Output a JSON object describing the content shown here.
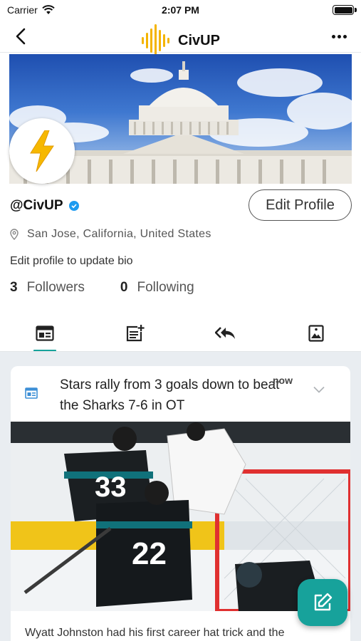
{
  "status_bar": {
    "carrier": "Carrier",
    "time": "2:07 PM"
  },
  "nav": {
    "app_name": "CivUP",
    "back_icon": "chevron-left-icon",
    "more_icon": "more-horizontal-icon",
    "logo_icon": "soundwave-logo-icon"
  },
  "profile": {
    "handle": "@CivUP",
    "verified": true,
    "edit_label": "Edit Profile",
    "location": "San Jose, California, United States",
    "bio": "Edit profile to update bio",
    "followers_count": "3",
    "followers_label": "Followers",
    "following_count": "0",
    "following_label": "Following",
    "avatar_icon": "lightning-bolt-icon",
    "cover_image": "capitol-building-photo"
  },
  "tabs": [
    {
      "name": "posts",
      "icon": "article-icon",
      "active": true
    },
    {
      "name": "create",
      "icon": "post-add-icon",
      "active": false
    },
    {
      "name": "replies",
      "icon": "reply-all-icon",
      "active": false
    },
    {
      "name": "media",
      "icon": "image-icon",
      "active": false
    }
  ],
  "feed": {
    "post": {
      "type_icon": "article-icon",
      "title": "Stars rally from 3 goals down to beat the Sharks 7-6 in OT",
      "time": "now",
      "image": "hockey-game-photo",
      "excerpt": "Wyatt Johnston had his first career hat trick and the"
    }
  },
  "fab": {
    "icon": "compose-icon"
  },
  "colors": {
    "accent": "#17a29b",
    "verified": "#1d9bf0",
    "feed_bg": "#e9edf1"
  }
}
